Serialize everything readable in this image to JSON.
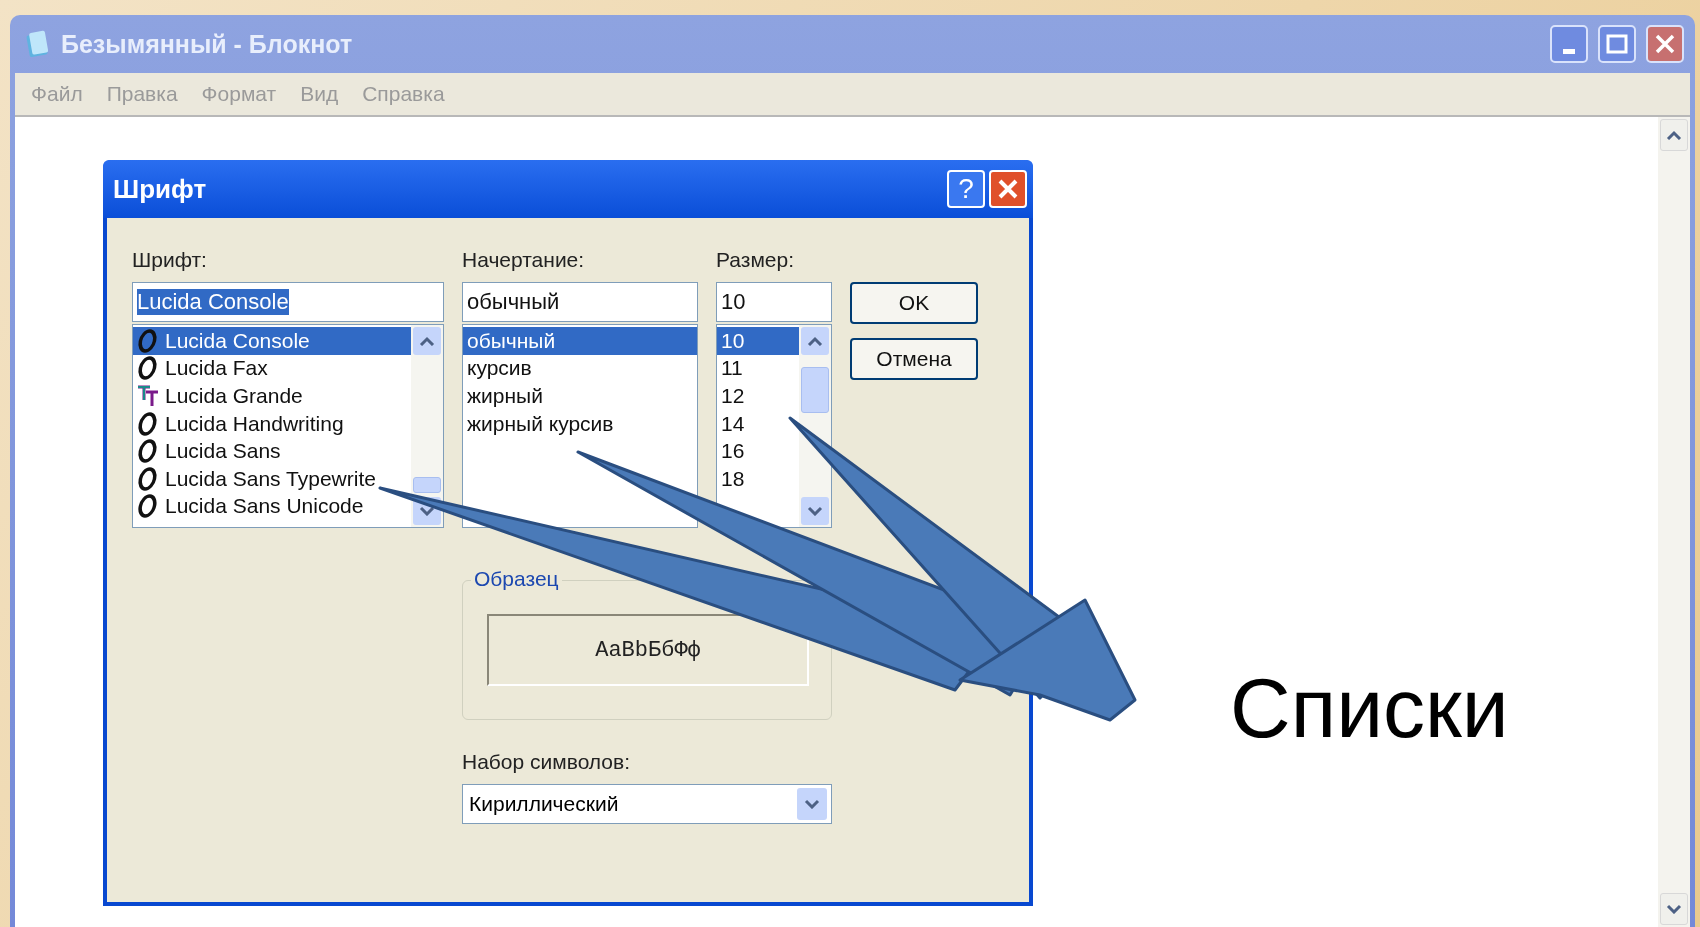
{
  "window": {
    "title": "Безымянный - Блокнот"
  },
  "menu": [
    "Файл",
    "Правка",
    "Формат",
    "Вид",
    "Справка"
  ],
  "dialog": {
    "title": "Шрифт",
    "help": "?",
    "font": {
      "label": "Шрифт:",
      "value": "Lucida Console",
      "items": [
        {
          "text": "Lucida Console",
          "kind": "opentype",
          "selected": true
        },
        {
          "text": "Lucida Fax",
          "kind": "opentype",
          "selected": false
        },
        {
          "text": "Lucida Grande",
          "kind": "truetype",
          "selected": false
        },
        {
          "text": "Lucida Handwriting",
          "kind": "opentype",
          "selected": false
        },
        {
          "text": "Lucida Sans",
          "kind": "opentype",
          "selected": false
        },
        {
          "text": "Lucida Sans Typewrite",
          "kind": "opentype",
          "selected": false
        },
        {
          "text": "Lucida Sans Unicode",
          "kind": "opentype",
          "selected": false
        }
      ]
    },
    "style": {
      "label": "Начертание:",
      "value": "обычный",
      "items": [
        {
          "text": "обычный",
          "selected": true
        },
        {
          "text": "курсив",
          "selected": false
        },
        {
          "text": "жирный",
          "selected": false
        },
        {
          "text": "жирный курсив",
          "selected": false
        }
      ]
    },
    "size": {
      "label": "Размер:",
      "value": "10",
      "items": [
        {
          "text": "10",
          "selected": true
        },
        {
          "text": "11",
          "selected": false
        },
        {
          "text": "12",
          "selected": false
        },
        {
          "text": "14",
          "selected": false
        },
        {
          "text": "16",
          "selected": false
        },
        {
          "text": "18",
          "selected": false
        }
      ]
    },
    "buttons": [
      "OK",
      "Отмена"
    ],
    "sample": {
      "label": "Образец",
      "text": "AaBbБбФф"
    },
    "charset": {
      "label": "Набор символов:",
      "value": "Кириллический"
    }
  },
  "callout": {
    "text": "Списки"
  }
}
